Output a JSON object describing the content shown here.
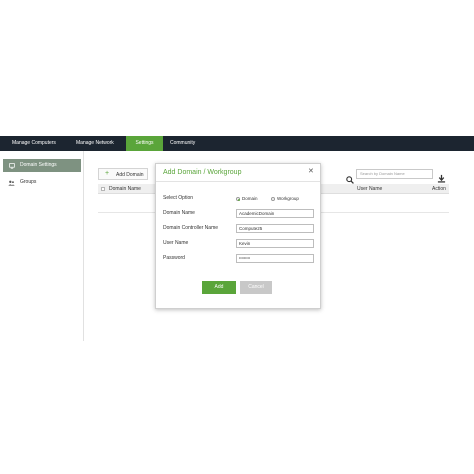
{
  "nav": {
    "items": [
      {
        "label": "Manage Computers"
      },
      {
        "label": "Manage Network"
      },
      {
        "label": "Settings"
      },
      {
        "label": "Community"
      }
    ],
    "active_index": 2
  },
  "sidebar": {
    "items": [
      {
        "label": "Domain Settings",
        "icon": "domain-icon",
        "active": true
      },
      {
        "label": "Groups",
        "icon": "groups-icon",
        "active": false
      }
    ]
  },
  "main": {
    "add_button": "Add Domain",
    "search_placeholder": "Search by Domain Name",
    "table": {
      "columns": [
        "Domain Name",
        "User Name",
        "Action"
      ]
    }
  },
  "modal": {
    "title": "Add Domain / Workgroup",
    "select_option_label": "Select Option",
    "options": [
      "Domain",
      "Workgroup"
    ],
    "selected_option": "Domain",
    "fields": [
      {
        "label": "Domain Name",
        "value": "AcademicDomain"
      },
      {
        "label": "Domain Controller Name",
        "value": "Compute25"
      },
      {
        "label": "User Name",
        "value": "Kevin"
      },
      {
        "label": "Password",
        "value": "•••••••••"
      }
    ],
    "add_label": "Add",
    "cancel_label": "Cancel"
  },
  "colors": {
    "accent": "#5aa53a",
    "nav_bg": "#1c2530",
    "sidebar_active": "#7e9281"
  }
}
